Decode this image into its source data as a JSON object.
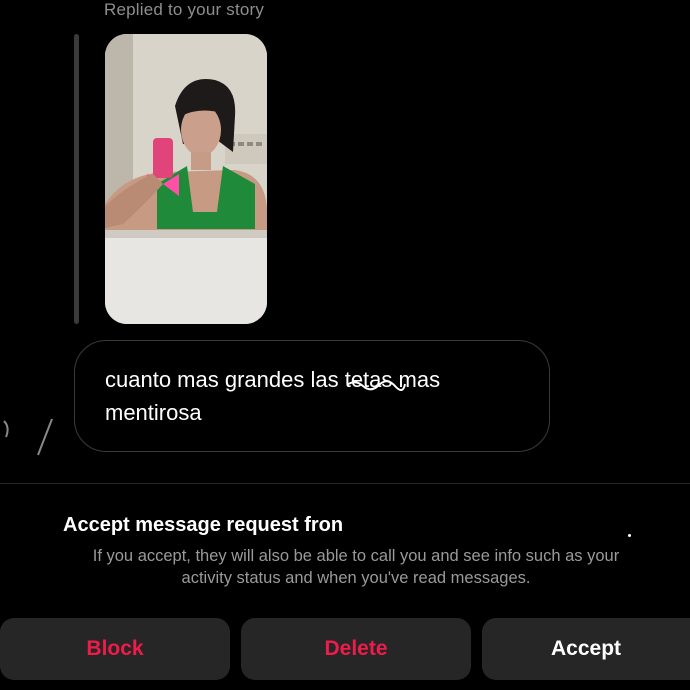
{
  "replied_label": "Replied to your story",
  "message": {
    "part1": "cuanto mas grandes las",
    "struck_word": "tetas",
    "part2": "mas",
    "line2": "mentirosa"
  },
  "request": {
    "title": "Accept message request fron",
    "info_line1": "If you accept, they will also be able to call you and see info such as your",
    "info_line2": "activity status and when you've read messages."
  },
  "buttons": {
    "block": "Block",
    "delete": "Delete",
    "accept": "Accept"
  },
  "colors": {
    "background": "#000000",
    "button_bg": "#262626",
    "destructive": "#ed1c4a",
    "muted_text": "#8e8e8e"
  },
  "icons": {
    "story_thumbnail": "story-photo"
  }
}
